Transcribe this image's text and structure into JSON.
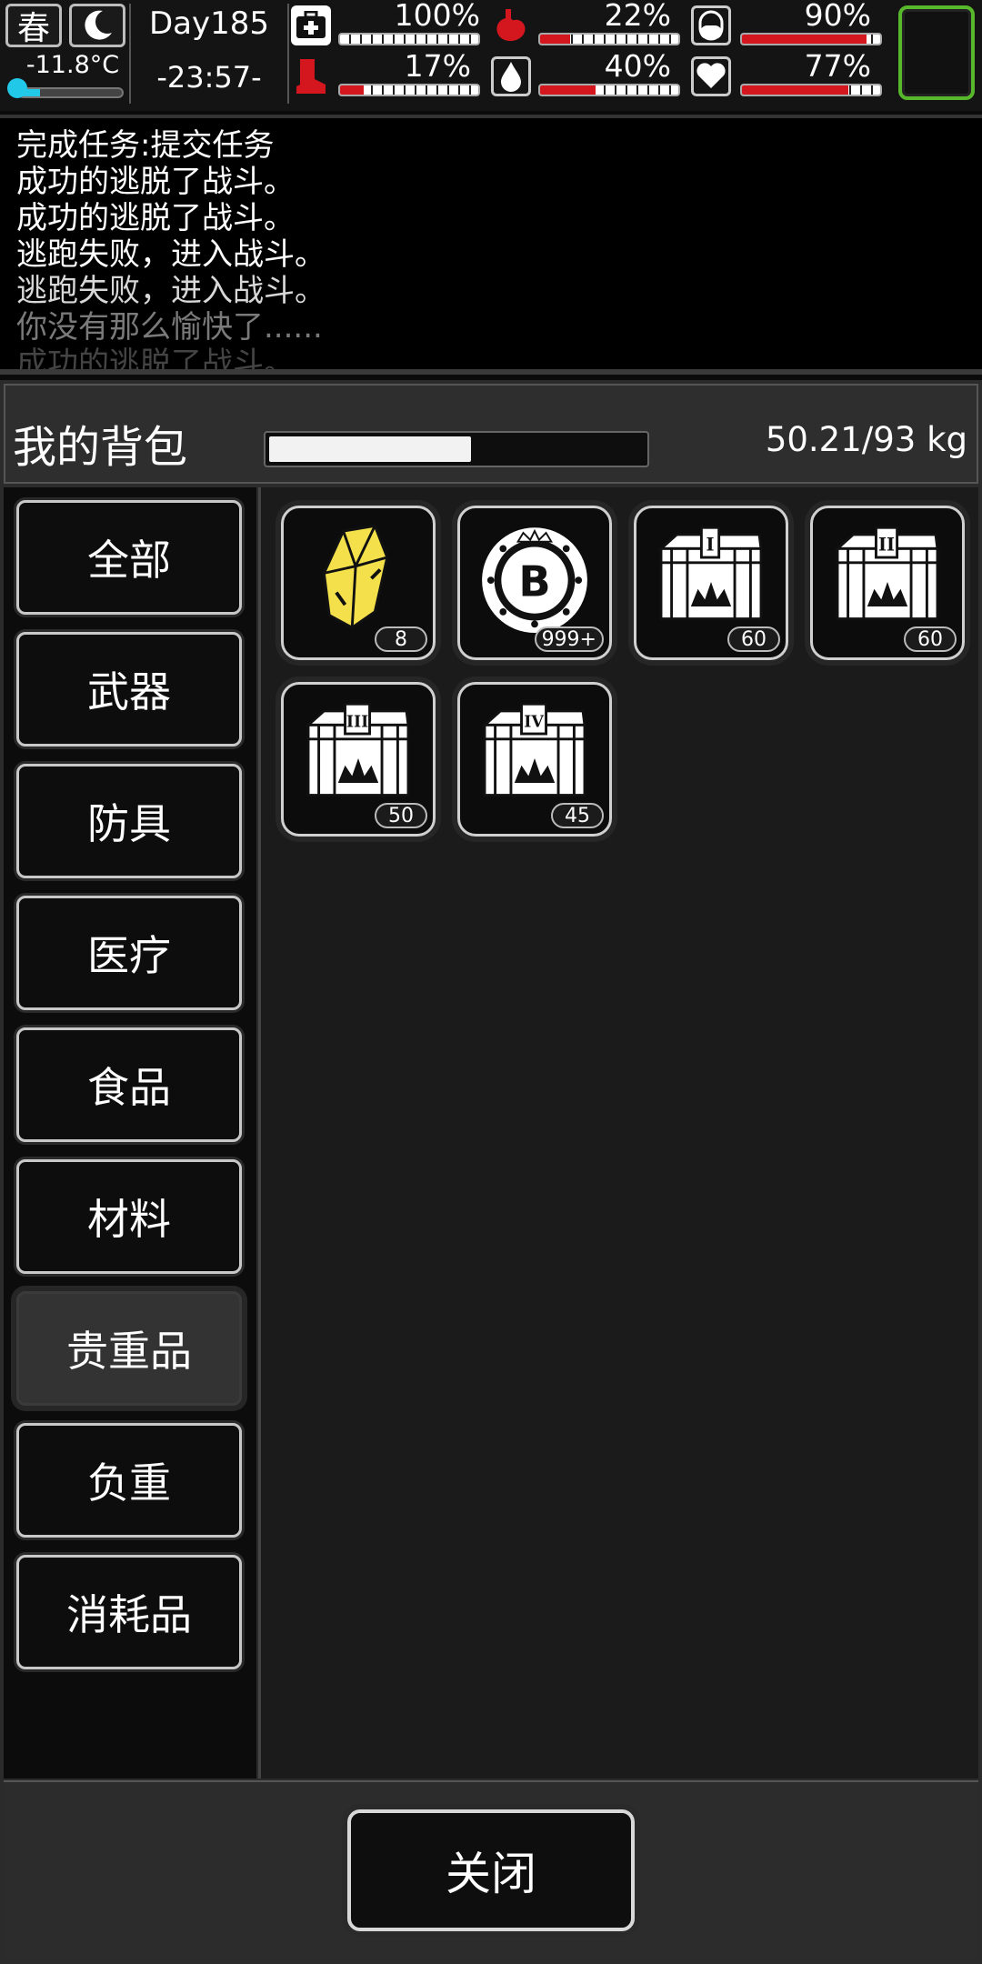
{
  "status": {
    "season": "春",
    "temperature": "-11.8°C",
    "temperature_level": 0.2,
    "day": "Day185",
    "time": "-23:57-",
    "stats": [
      {
        "icon": "medkit-icon",
        "value": "100%",
        "level": 1.0
      },
      {
        "icon": "stomach-icon",
        "value": "22%",
        "level": 0.22
      },
      {
        "icon": "pill-icon",
        "value": "90%",
        "level": 0.9
      },
      {
        "icon": "boot-icon",
        "value": "17%",
        "level": 0.17
      },
      {
        "icon": "water-drop-icon",
        "value": "40%",
        "level": 0.4
      },
      {
        "icon": "heart-icon",
        "value": "77%",
        "level": 0.77
      }
    ]
  },
  "log": {
    "lines": [
      "完成任务:提交任务",
      "成功的逃脱了战斗。",
      "成功的逃脱了战斗。",
      "逃跑失败，进入战斗。",
      "逃跑失败，进入战斗。",
      "你没有那么愉快了......",
      "成功的逃脱了战斗。"
    ]
  },
  "bag": {
    "title": "我的背包",
    "weight": "50.21/93 kg",
    "weight_level": 0.54,
    "categories": [
      "全部",
      "武器",
      "防具",
      "医疗",
      "食品",
      "材料",
      "贵重品",
      "负重",
      "消耗品"
    ],
    "active_category": "贵重品",
    "items": [
      {
        "icon": "gold-nugget-icon",
        "count": "8"
      },
      {
        "icon": "coin-token-icon",
        "count": "999+"
      },
      {
        "icon": "chest-i-icon",
        "count": "60"
      },
      {
        "icon": "chest-ii-icon",
        "count": "60"
      },
      {
        "icon": "chest-iii-icon",
        "count": "50"
      },
      {
        "icon": "chest-iv-icon",
        "count": "45"
      }
    ],
    "close_label": "关闭"
  },
  "colors": {
    "stat_red": "#d4161e",
    "temperature_cyan": "#22c8e8",
    "slot_green": "#58b82c",
    "gold": "#f3e04a"
  }
}
